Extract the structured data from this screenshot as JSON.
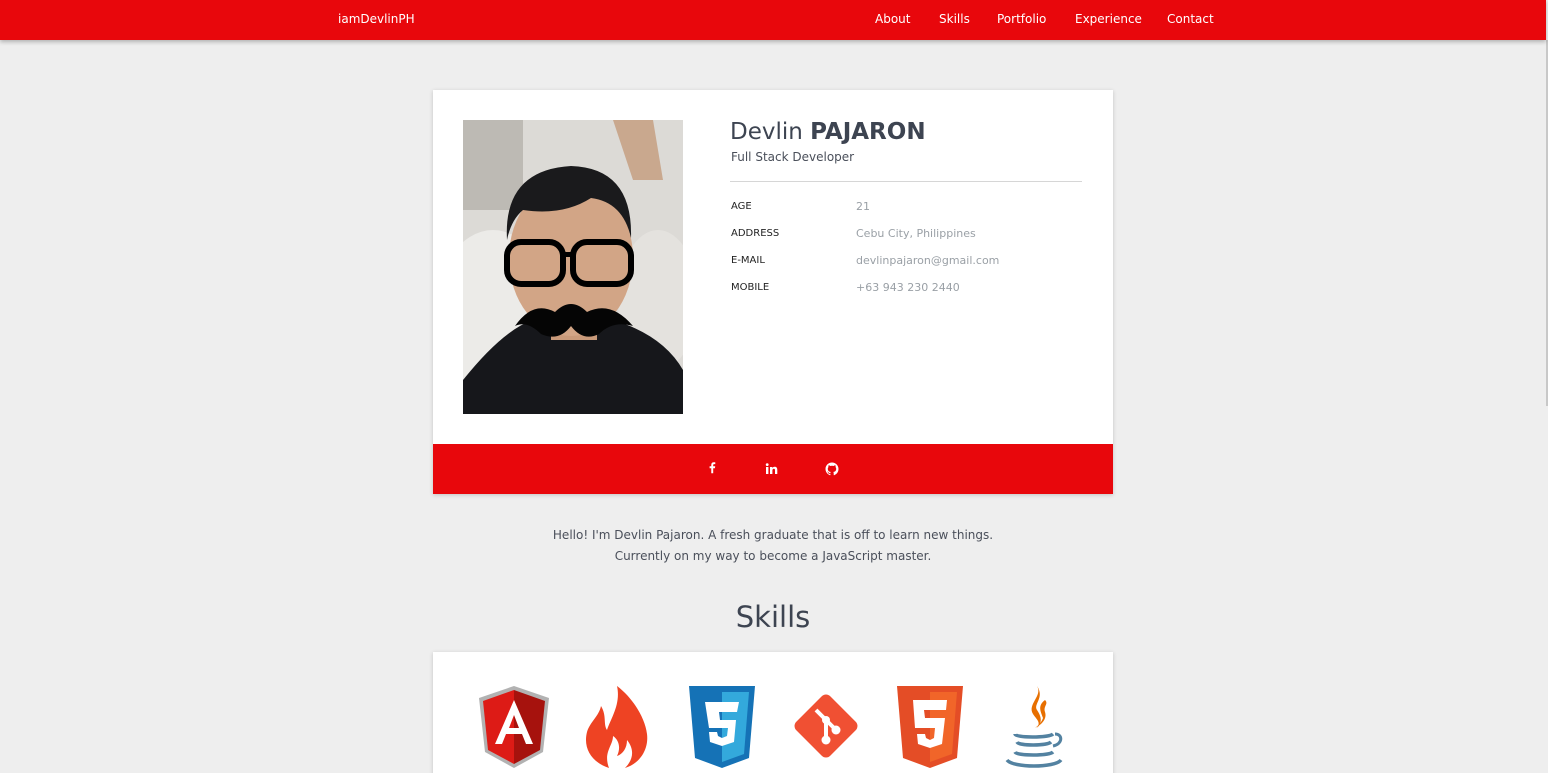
{
  "navbar": {
    "brand": "iamDevlinPH",
    "links": [
      "About",
      "Skills",
      "Portfolio",
      "Experience",
      "Contact"
    ]
  },
  "profile": {
    "first_name": "Devlin",
    "last_name": "PAJARON",
    "role": "Full Stack Developer",
    "info": [
      {
        "label": "AGE",
        "value": "21"
      },
      {
        "label": "ADDRESS",
        "value": "Cebu City, Philippines"
      },
      {
        "label": "E-MAIL",
        "value": "devlinpajaron@gmail.com"
      },
      {
        "label": "MOBILE",
        "value": "+63 943 230 2440"
      }
    ],
    "social_icons": [
      "facebook-icon",
      "linkedin-icon",
      "github-icon"
    ]
  },
  "about": {
    "line1": "Hello! I'm Devlin Pajaron. A fresh graduate that is off to learn new things.",
    "line2": "Currently on my way to become a JavaScript master."
  },
  "skills": {
    "title": "Skills",
    "icons": [
      "angularjs-icon",
      "codeigniter-icon",
      "css3-icon",
      "git-icon",
      "html5-icon",
      "java-icon"
    ]
  },
  "colors": {
    "accent": "#e8070c",
    "background": "#eeeeee",
    "heading": "#3d4451"
  }
}
